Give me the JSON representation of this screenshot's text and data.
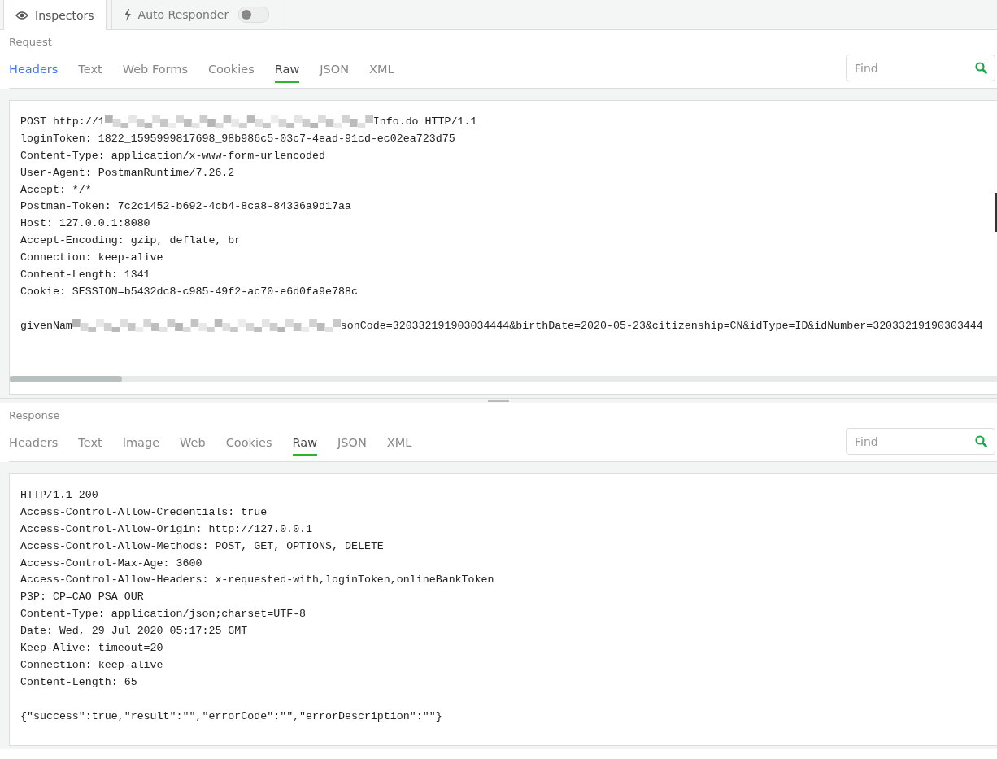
{
  "top_tabs": [
    {
      "label": "Inspectors",
      "selected": true
    },
    {
      "label": "Auto Responder",
      "selected": false,
      "toggle": {
        "on": false
      }
    }
  ],
  "request": {
    "label": "Request",
    "tabs": [
      {
        "label": "Headers",
        "selected": false,
        "highlighted": true
      },
      {
        "label": "Text",
        "selected": false,
        "highlighted": false
      },
      {
        "label": "Web Forms",
        "selected": false,
        "highlighted": false
      },
      {
        "label": "Cookies",
        "selected": false,
        "highlighted": false
      },
      {
        "label": "Raw",
        "selected": true,
        "highlighted": false
      },
      {
        "label": "JSON",
        "selected": false,
        "highlighted": false
      },
      {
        "label": "XML",
        "selected": false,
        "highlighted": false
      }
    ],
    "find": {
      "placeholder": "Find"
    },
    "lines": [
      {
        "kind": "redacted",
        "text": "POST http://1",
        "after": "Info.do HTTP/1.1"
      },
      {
        "text": "loginToken: 1822_1595999817698_98b986c5-03c7-4ead-91cd-ec02ea723d75"
      },
      {
        "text": "Content-Type: application/x-www-form-urlencoded"
      },
      {
        "text": "User-Agent: PostmanRuntime/7.26.2"
      },
      {
        "text": "Accept: */*"
      },
      {
        "text": "Postman-Token: 7c2c1452-b692-4cb4-8ca8-84336a9d17aa"
      },
      {
        "text": "Host: 127.0.0.1:8080"
      },
      {
        "text": "Accept-Encoding: gzip, deflate, br"
      },
      {
        "text": "Connection: keep-alive"
      },
      {
        "text": "Content-Length: 1341"
      },
      {
        "text": "Cookie: SESSION=b5432dc8-c985-49f2-ac70-e6d0fa9e788c"
      }
    ],
    "body": {
      "kind": "redacted",
      "text": "givenNam",
      "after": "sonCode=320332191903034444&birthDate=2020-05-23&citizenship=CN&idType=ID&idNumber=32033219190303444"
    }
  },
  "response": {
    "label": "Response",
    "tabs": [
      {
        "label": "Headers",
        "selected": false,
        "highlighted": false
      },
      {
        "label": "Text",
        "selected": false,
        "highlighted": false
      },
      {
        "label": "Image",
        "selected": false,
        "highlighted": false
      },
      {
        "label": "Web",
        "selected": false,
        "highlighted": false
      },
      {
        "label": "Cookies",
        "selected": false,
        "highlighted": false
      },
      {
        "label": "Raw",
        "selected": true,
        "highlighted": false
      },
      {
        "label": "JSON",
        "selected": false,
        "highlighted": false
      },
      {
        "label": "XML",
        "selected": false,
        "highlighted": false
      }
    ],
    "find": {
      "placeholder": "Find"
    },
    "lines": [
      {
        "text": "HTTP/1.1 200"
      },
      {
        "text": "Access-Control-Allow-Credentials: true"
      },
      {
        "text": "Access-Control-Allow-Origin: http://127.0.0.1"
      },
      {
        "text": "Access-Control-Allow-Methods: POST, GET, OPTIONS, DELETE"
      },
      {
        "text": "Access-Control-Max-Age: 3600"
      },
      {
        "text": "Access-Control-Allow-Headers: x-requested-with,loginToken,onlineBankToken"
      },
      {
        "text": "P3P: CP=CAO PSA OUR"
      },
      {
        "text": "Content-Type: application/json;charset=UTF-8"
      },
      {
        "text": "Date: Wed, 29 Jul 2020 05:17:25 GMT"
      },
      {
        "text": "Keep-Alive: timeout=20"
      },
      {
        "text": "Connection: keep-alive"
      },
      {
        "text": "Content-Length: 65"
      }
    ],
    "body": {
      "text": "{\"success\":true,\"result\":\"\",\"errorCode\":\"\",\"errorDescription\":\"\"}"
    }
  }
}
